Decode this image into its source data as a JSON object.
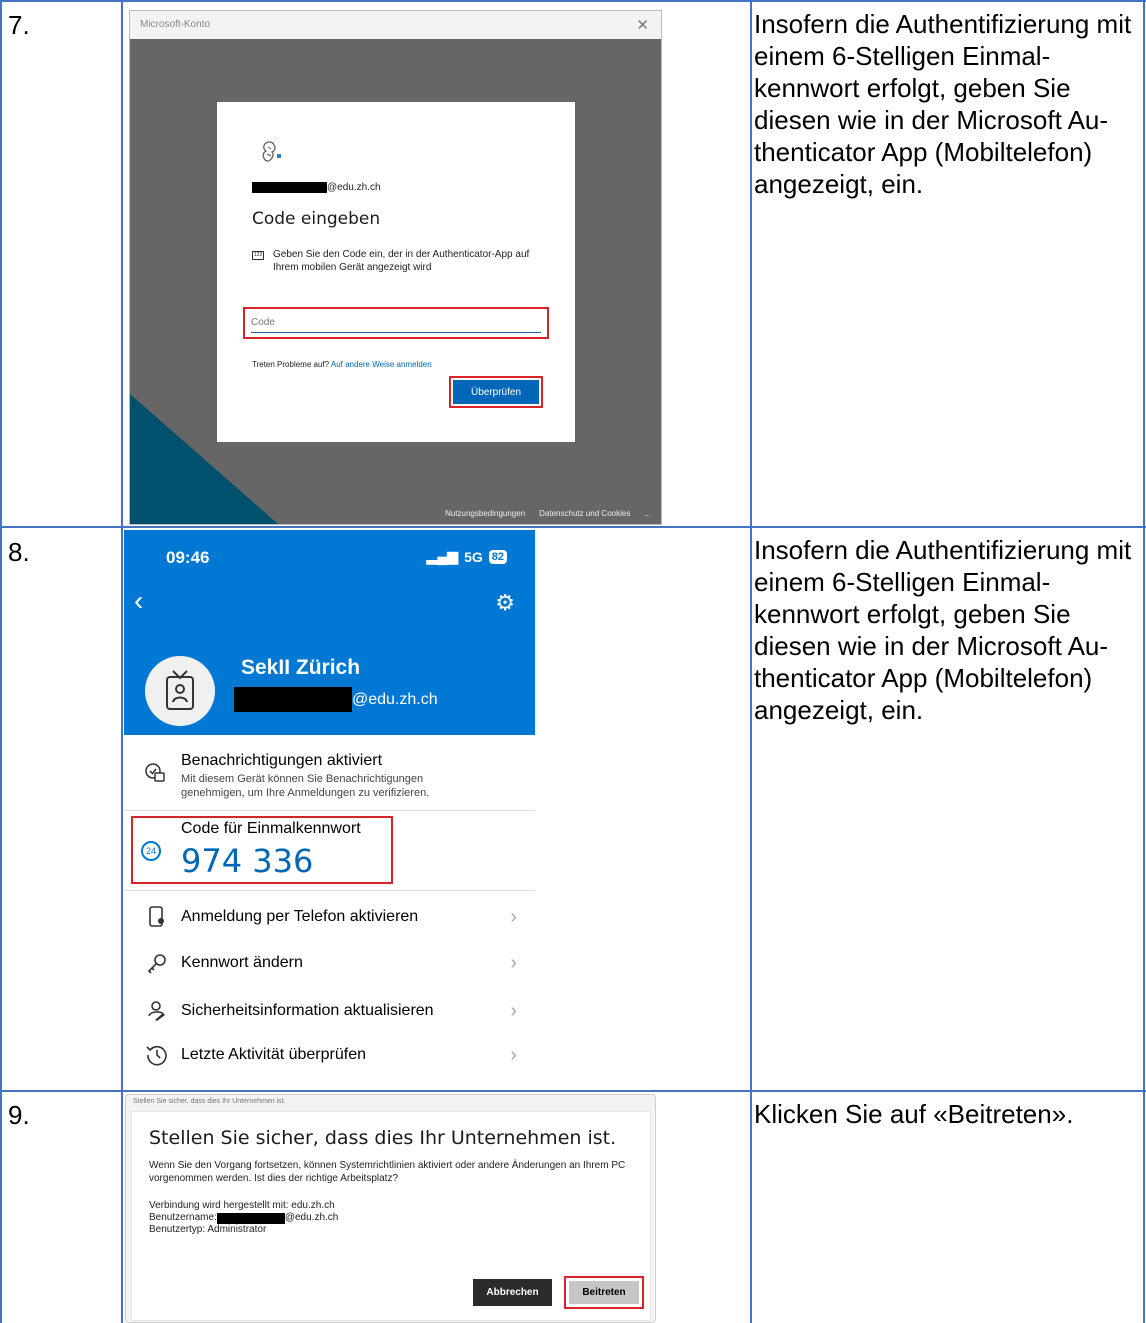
{
  "steps": [
    {
      "number": "7.",
      "instruction": "Insofern die Authentifizierung mit einem 6-Stelligen Einmal-kennwort erfolgt, geben Sie diesen wie in der Microsoft Au-thenticator App (Mobiltelefon) angezeigt, ein."
    },
    {
      "number": "8.",
      "instruction": "Insofern die Authentifizierung mit einem 6-Stelligen Einmal-kennwort erfolgt, geben Sie diesen wie in der Microsoft Au-thenticator App (Mobiltelefon) angezeigt, ein."
    },
    {
      "number": "9.",
      "instruction": "Klicken Sie auf «Beitreten»."
    }
  ],
  "ms_dialog": {
    "window_title": "Microsoft-Konto",
    "account_suffix": "@edu.zh.ch",
    "heading": "Code eingeben",
    "info_icon_text": "123",
    "info": "Geben Sie den Code ein, der in der Authenticator-App auf Ihrem mobilen Gerät angezeigt wird",
    "code_placeholder": "Code",
    "help_text": "Treten Probleme auf?",
    "help_link": "Auf andere Weise anmelden",
    "verify_button": "Überprüfen",
    "footer_terms": "Nutzungsbedingungen",
    "footer_privacy": "Datenschutz und Cookies",
    "footer_more": "..."
  },
  "authenticator": {
    "time": "09:46",
    "network": "5G",
    "battery": "82",
    "org_name": "SekII Zürich",
    "email_suffix": "@edu.zh.ch",
    "notifications_title": "Benachrichtigungen aktiviert",
    "notifications_desc_1": "Mit diesem Gerät können Sie Benachrichtigungen",
    "notifications_desc_2": "genehmigen, um Ihre Anmeldungen zu verifizieren.",
    "otp_timer": "24",
    "otp_label": "Code für Einmalkennwort",
    "otp_code": "974 336",
    "menu": [
      {
        "label": "Anmeldung per Telefon aktivieren",
        "icon": "phone-sign-in-icon"
      },
      {
        "label": "Kennwort ändern",
        "icon": "key-icon"
      },
      {
        "label": "Sicherheitsinformation aktualisieren",
        "icon": "person-edit-icon"
      },
      {
        "label": "Letzte Aktivität überprüfen",
        "icon": "history-icon"
      }
    ]
  },
  "confirm_dialog": {
    "window_title": "Stellen Sie sicher, dass dies Ihr Unternehmen ist.",
    "heading": "Stellen Sie sicher, dass dies Ihr Unternehmen ist.",
    "text": "Wenn Sie den Vorgang fortsetzen, können Systemrichtlinien aktiviert oder andere Änderungen an Ihrem PC vorgenommen werden. Ist dies der richtige Arbeitsplatz?",
    "connection": "Verbindung wird hergestellt mit: edu.zh.ch",
    "username_label": "Benutzername:",
    "username_suffix": "@edu.zh.ch",
    "usertype": "Benutzertyp: Administrator",
    "cancel_button": "Abbrechen",
    "join_button": "Beitreten"
  },
  "colors": {
    "table_border": "#4472c4",
    "highlight": "#d8232a",
    "ms_blue": "#0067b8",
    "authenticator_blue": "#0078d4"
  }
}
